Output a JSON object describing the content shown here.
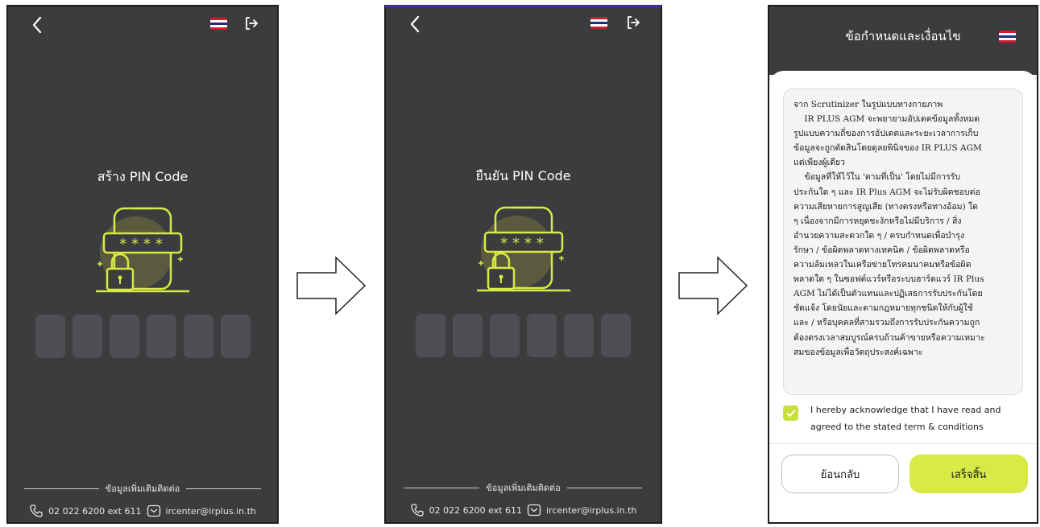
{
  "screen1": {
    "title": "สร้าง PIN Code",
    "pin_boxes": 6,
    "footer_label": "ข้อมูลเพิ่มเติมติดต่อ",
    "phone": "02 022 6200 ext 611",
    "email": "ircenter@irplus.in.th"
  },
  "screen2": {
    "title": "ยืนยัน PIN Code",
    "pin_boxes": 6,
    "footer_label": "ข้อมูลเพิ่มเติมติดต่อ",
    "phone": "02 022 6200 ext 611",
    "email": "ircenter@irplus.in.th"
  },
  "screen3": {
    "title": "ข้อกำหนดและเงื่อนไข",
    "terms_text": [
      "จาก Scrutinizer ในรูปแบบทางกายภาพ",
      "    IR PLUS AGM จะพยายามอัปเดตข้อมูลทั้งหมด",
      "รูปแบบความถี่ของการอัปเดตและระยะเวลาการเก็บ",
      "ข้อมูลจะถูกตัดสินโดยดุลยพินิจของ IR PLUS AGM",
      "แต่เพียงผู้เดียว",
      "    ข้อมูลที่ให้ไว้ใน 'ตามที่เป็น' โดยไม่มีการรับ",
      "ประกันใด ๆ และ IR Plus AGM จะไม่รับผิดชอบต่อ",
      "ความเสียหายการสูญเสีย (ทางตรงหรือทางอ้อม) ใด",
      "ๆ เนื่องจากมีการหยุดชะงักหรือไม่มีบริการ / สิ่ง",
      "อำนวยความสะดวกใด ๆ / ครบกำหนดเพื่อบำรุง",
      "รักษา / ข้อผิดพลาดทางเทคนิค / ข้อผิดพลาดหรือ",
      "ความล้มเหลวในเครือข่ายโทรคมนาคมหรือข้อผิด",
      "พลาดใด ๆ ในซอฟต์แวร์หรือระบบฮาร์ดแวร์ IR Plus",
      "AGM ไม่ได้เป็นตัวแทนและปฏิเสธการรับประกันโดย",
      "ชัดแจ้ง โดยนัยและตามกฎหมายทุกชนิดให้กับผู้ใช้",
      "และ / หรือบุคคลที่สามรวมถึงการรับประกันความถูก",
      "ต้องตรงเวลาสมบูรณ์ครบถ้วนค้าขายหรือความเหมาะ",
      "สมของข้อมูลเพื่อวัตถุประสงค์เฉพาะ"
    ],
    "agree_text": "I hereby acknowledge that I have read and agreed to the stated term & conditions",
    "agree_checked": true,
    "back_label": "ย้อนกลับ",
    "done_label": "เสร็จสิ้น"
  },
  "colors": {
    "background": "#3b3c3e",
    "accent": "#d8ea45",
    "pin_box": "#4e4f52"
  },
  "icons": [
    "back-arrow-icon",
    "thai-flag-icon",
    "logout-icon",
    "phone-icon",
    "email-icon",
    "lock-pin-illustration",
    "right-arrow-icon",
    "check-icon"
  ]
}
